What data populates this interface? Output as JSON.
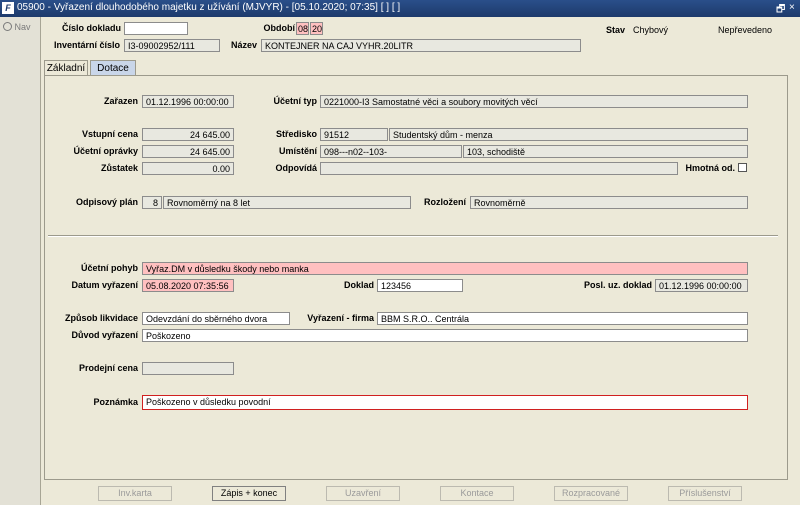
{
  "window": {
    "title": "05900 - Vyřazení dlouhodobého majetku z užívání (MJVYR) - [05.10.2020; 07:35]  [ ] [ ]",
    "app_icon": "F",
    "restore_glyph": "🗗",
    "close_glyph": "×"
  },
  "nav": {
    "label": "Nav",
    "icon": "globe-icon"
  },
  "header": {
    "cislo_dokladu_label": "Číslo dokladu",
    "cislo_dokladu_value": "",
    "obdobi_label": "Období",
    "obdobi_month": "08",
    "obdobi_year": "20",
    "stav_label": "Stav",
    "stav_value": "Chybový",
    "stav_extra": "Nepřevedeno",
    "inventarni_cislo_label": "Inventární číslo",
    "inventarni_cislo_value": "I3-09002952/111",
    "nazev_label": "Název",
    "nazev_value": "KONTEJNER NA CAJ VYHR.20LITR"
  },
  "tabs": [
    {
      "label": "Základní",
      "active": true
    },
    {
      "label": "Dotace",
      "active": false
    }
  ],
  "form": {
    "zarazen_label": "Zařazen",
    "zarazen_value": "01.12.1996 00:00:00",
    "ucetni_typ_label": "Účetní typ",
    "ucetni_typ_value": "0221000-I3 Samostatné věci a soubory movitých věcí",
    "vstupni_cena_label": "Vstupní cena",
    "vstupni_cena_value": "24 645.00",
    "stredisko_label": "Středisko",
    "stredisko_code": "91512",
    "stredisko_name": "Studentský dům - menza",
    "ucetni_opravky_label": "Účetní oprávky",
    "ucetni_opravky_value": "24 645.00",
    "umisteni_label": "Umístění",
    "umisteni_code": "098---n02--103-",
    "umisteni_name": "103, schodiště",
    "zustatek_label": "Zůstatek",
    "zustatek_value": "0.00",
    "odpovida_label": "Odpovídá",
    "odpovida_value": "",
    "hmotna_label": "Hmotná od.",
    "odpisovy_plan_label": "Odpisový plán",
    "odpisovy_plan_code": "8",
    "odpisovy_plan_name": "Rovnoměrný na  8 let",
    "rozlozeni_label": "Rozložení",
    "rozlozeni_value": "Rovnoměrně",
    "ucetni_pohyb_label": "Účetní pohyb",
    "ucetni_pohyb_value": "Vyřaz.DM v důsledku škody nebo manka",
    "datum_vyrazeni_label": "Datum vyřazení",
    "datum_vyrazeni_value": "05.08.2020 07:35:56",
    "doklad_label": "Doklad",
    "doklad_value": "123456",
    "posl_uz_doklad_label": "Posl. uz. doklad",
    "posl_uz_doklad_value": "01.12.1996 00:00:00",
    "zpusob_likvidace_label": "Způsob likvidace",
    "zpusob_likvidace_value": "Odevzdání do sběrného dvora",
    "vyrazeni_firma_label": "Vyřazení - firma",
    "vyrazeni_firma_value": "BBM S.R.O.. Centrála",
    "duvod_vyrazeni_label": "Důvod vyřazení",
    "duvod_vyrazeni_value": "Poškozeno",
    "prodejni_cena_label": "Prodejní cena",
    "prodejni_cena_value": "",
    "poznamka_label": "Poznámka",
    "poznamka_value": "Poškozeno v důsledku povodní"
  },
  "buttons": {
    "inv_karta": "Inv.karta",
    "zapis_konec": "Zápis + konec",
    "uzavreni": "Uzavření",
    "kontace": "Kontace",
    "rozpracovane": "Rozpracované",
    "prislusenstvi": "Příslušenství"
  }
}
